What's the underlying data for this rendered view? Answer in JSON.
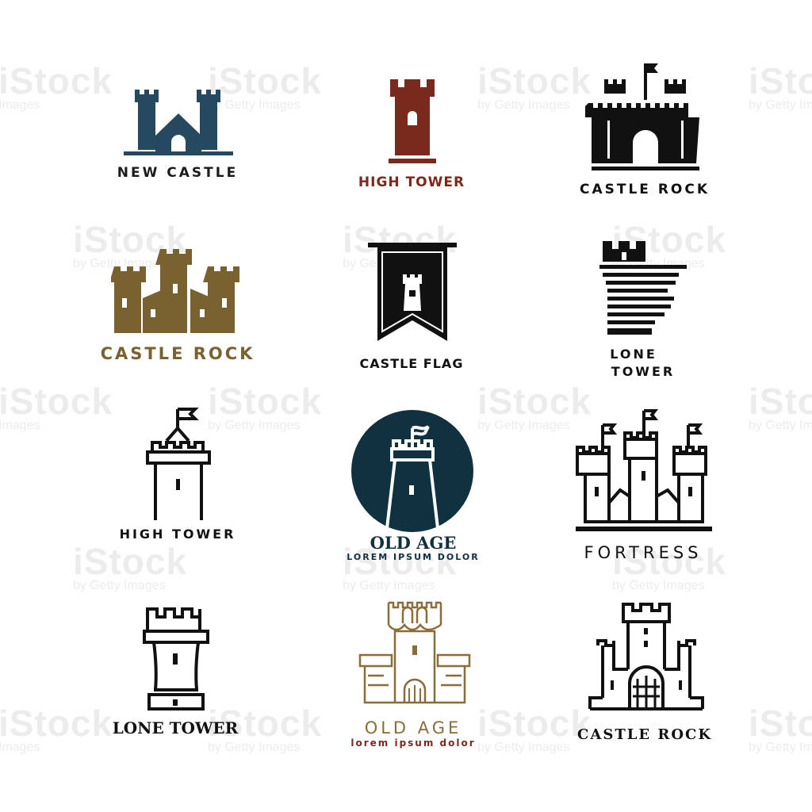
{
  "colors": {
    "navy_blue": "#25495f",
    "brick_red": "#7a2a1c",
    "black": "#111111",
    "bronze": "#7a6130",
    "dark_teal": "#10313f",
    "gold": "#8a6d3b"
  },
  "watermark": {
    "brand": "iStock",
    "credit": "by Getty Images"
  },
  "logos": [
    {
      "id": "new-castle",
      "title": "NEW CASTLE",
      "icon": "castle-two-towers-icon"
    },
    {
      "id": "high-tower-red",
      "title": "HIGH TOWER",
      "icon": "rook-tower-icon"
    },
    {
      "id": "castle-rock-black",
      "title": "CASTLE ROCK",
      "icon": "castle-flag-gate-icon"
    },
    {
      "id": "castle-rock-bronze",
      "title": "CASTLE ROCK",
      "icon": "castle-battlements-icon"
    },
    {
      "id": "castle-flag",
      "title": "CASTLE FLAG",
      "icon": "banner-tower-icon"
    },
    {
      "id": "lone-tower-striped",
      "title": "LONE",
      "title2": "TOWER",
      "icon": "striped-tower-icon"
    },
    {
      "id": "high-tower-outline",
      "title": "HIGH TOWER",
      "icon": "flag-tower-outline-icon"
    },
    {
      "id": "old-age-circle",
      "title": "OLD AGE",
      "subtitle": "LOREM IPSUM DOLOR",
      "icon": "circle-tower-icon"
    },
    {
      "id": "fortress",
      "title": "FORTRESS",
      "icon": "fortress-outline-icon"
    },
    {
      "id": "lone-tower-outline",
      "title": "LONE TOWER",
      "icon": "rook-outline-icon"
    },
    {
      "id": "old-age-gold",
      "title": "OLD AGE",
      "subtitle": "lorem ipsum dolor",
      "icon": "gothic-castle-icon"
    },
    {
      "id": "castle-rock-outline",
      "title": "CASTLE ROCK",
      "icon": "castle-portcullis-icon"
    }
  ]
}
